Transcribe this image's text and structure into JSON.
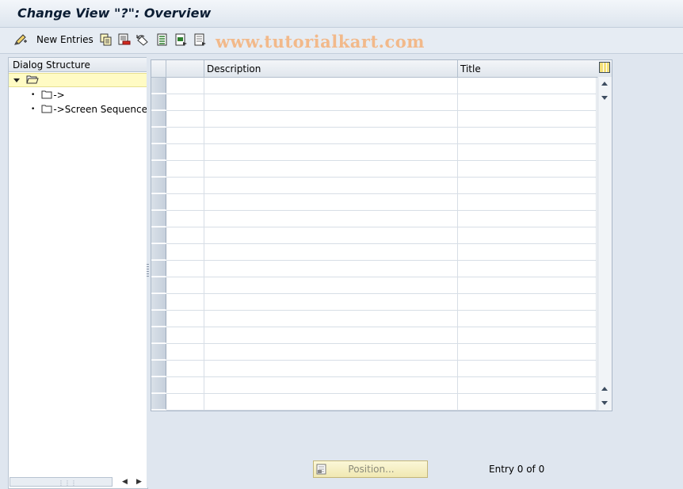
{
  "window": {
    "title": "Change View \"?\": Overview"
  },
  "toolbar": {
    "new_entries_label": "New Entries",
    "watermark": "www.tutorialkart.com"
  },
  "dialog_structure": {
    "header": "Dialog Structure",
    "items": [
      {
        "label": ""
      },
      {
        "label": "->"
      },
      {
        "label": "->Screen Sequences"
      }
    ]
  },
  "table": {
    "columns": [
      "Description",
      "Title"
    ],
    "row_count": 20
  },
  "footer": {
    "position_button_label": "Position...",
    "entry_status": "Entry 0 of 0"
  }
}
